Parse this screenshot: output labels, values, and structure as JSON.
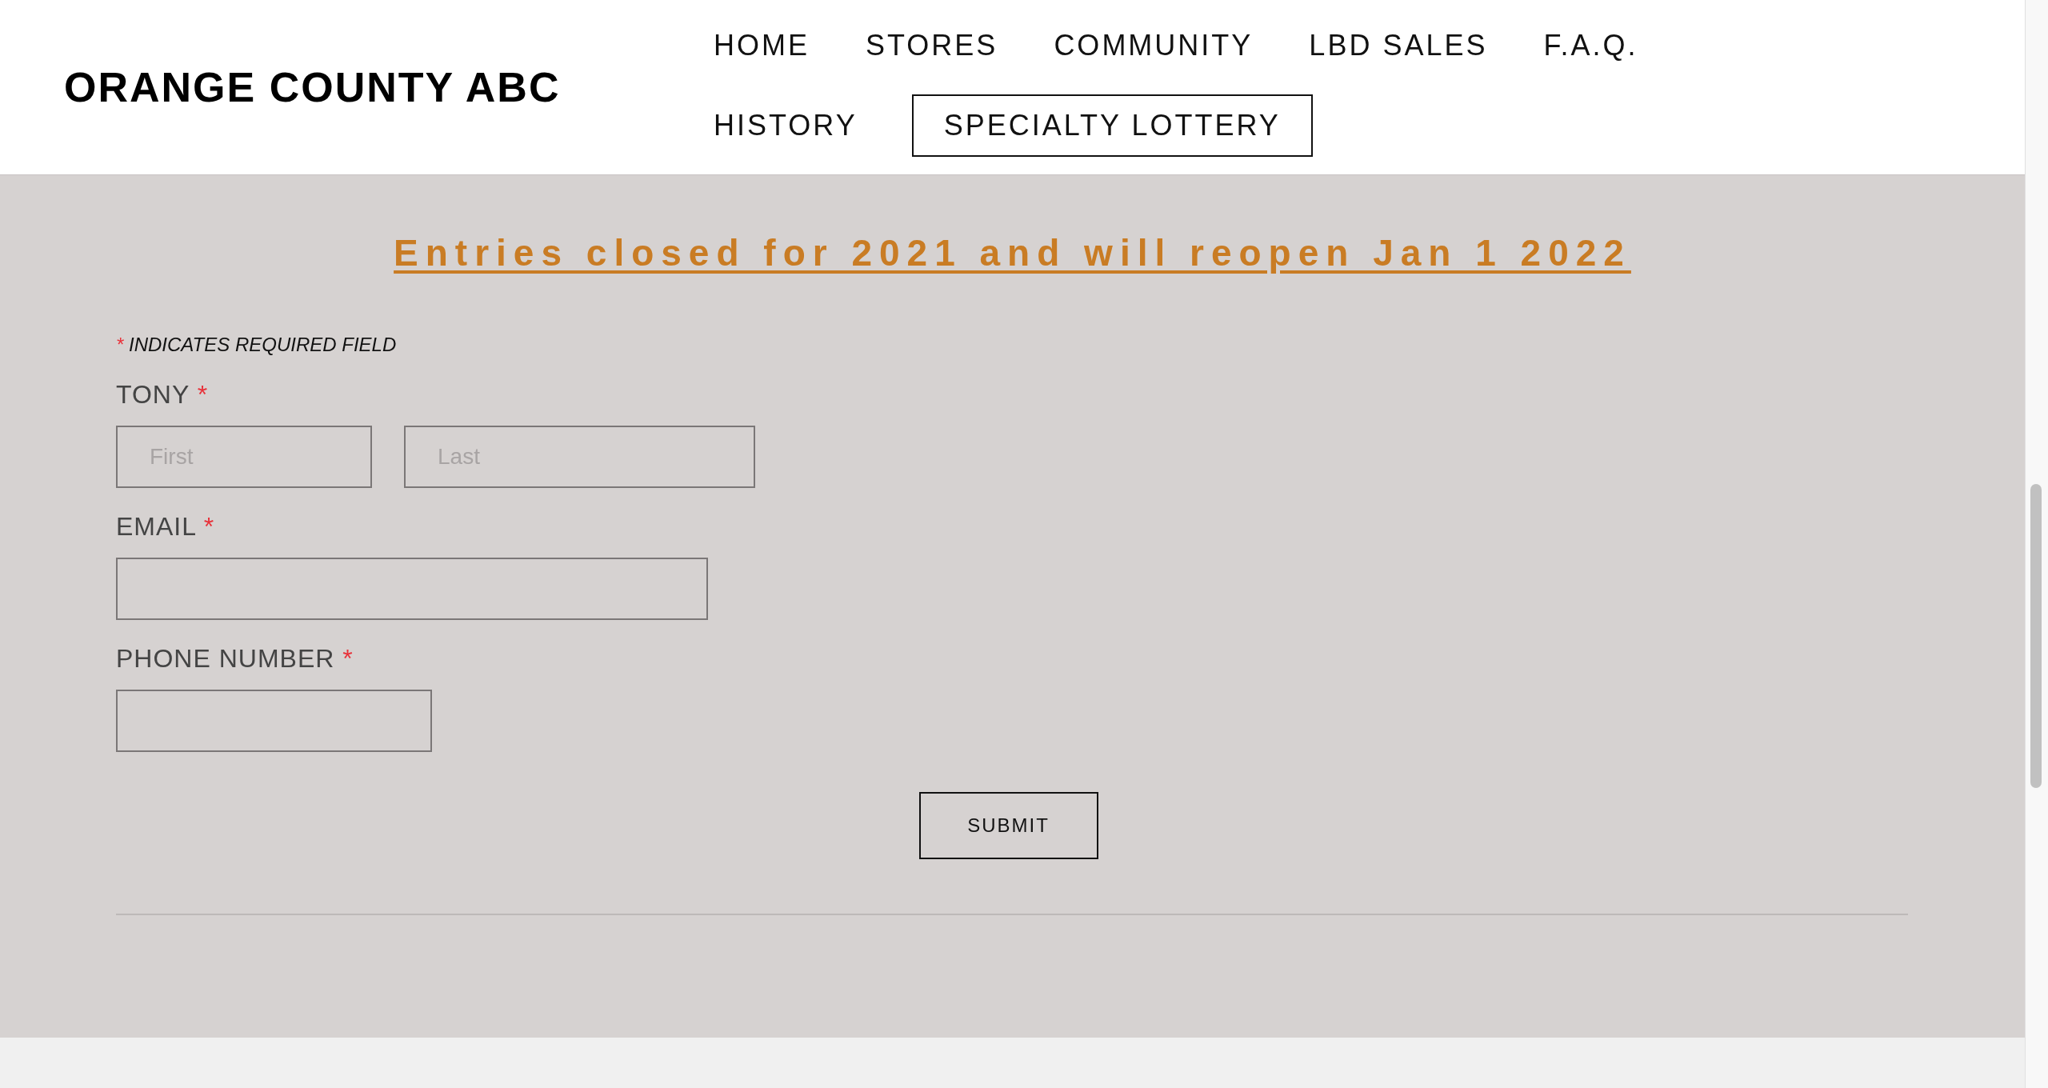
{
  "site_title": "ORANGE COUNTY ABC",
  "nav": [
    {
      "label": "HOME",
      "selected": false
    },
    {
      "label": "STORES",
      "selected": false
    },
    {
      "label": "COMMUNITY",
      "selected": false
    },
    {
      "label": "LBD SALES",
      "selected": false
    },
    {
      "label": "F.A.Q.",
      "selected": false
    },
    {
      "label": "HISTORY",
      "selected": false
    },
    {
      "label": "SPECIALTY LOTTERY",
      "selected": true
    }
  ],
  "heading": "Entries closed for 2021 and will reopen Jan 1 2022",
  "required_note": {
    "mark": "*",
    "text": "INDICATES REQUIRED FIELD"
  },
  "fields": [
    {
      "label": "TONY",
      "required_mark": "*",
      "kind": "name",
      "placeholders": [
        "First",
        "Last"
      ]
    },
    {
      "label": "EMAIL",
      "required_mark": "*",
      "kind": "email"
    },
    {
      "label": "PHONE NUMBER",
      "required_mark": "*",
      "kind": "phone"
    }
  ],
  "submit": "SUBMIT"
}
